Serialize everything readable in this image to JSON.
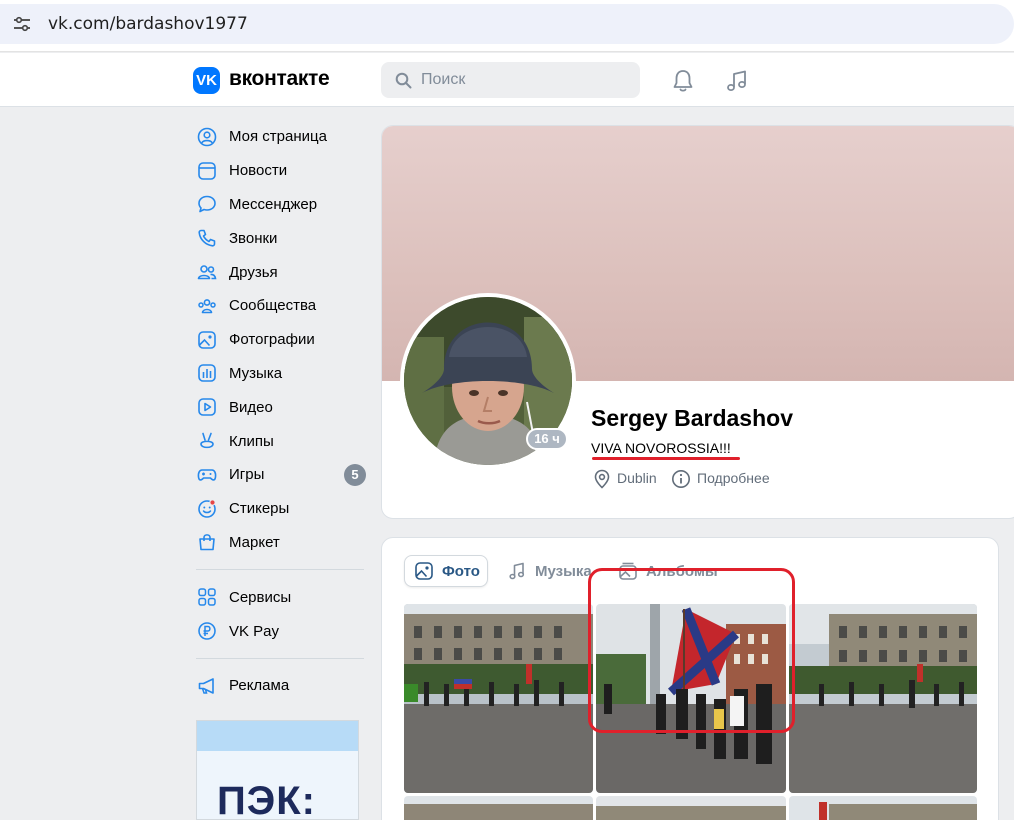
{
  "browser": {
    "url": "vk.com/bardashov1977"
  },
  "header": {
    "logo_text": "VK",
    "brand": "вконтакте",
    "search_placeholder": "Поиск"
  },
  "sidebar": {
    "items": [
      {
        "label": "Моя страница",
        "icon": "user-circle-icon"
      },
      {
        "label": "Новости",
        "icon": "news-icon"
      },
      {
        "label": "Мессенджер",
        "icon": "message-bubble-icon"
      },
      {
        "label": "Звонки",
        "icon": "phone-icon"
      },
      {
        "label": "Друзья",
        "icon": "friends-icon"
      },
      {
        "label": "Сообщества",
        "icon": "communities-icon"
      },
      {
        "label": "Фотографии",
        "icon": "photo-icon"
      },
      {
        "label": "Музыка",
        "icon": "music-bars-icon"
      },
      {
        "label": "Видео",
        "icon": "video-icon"
      },
      {
        "label": "Клипы",
        "icon": "clips-icon"
      },
      {
        "label": "Игры",
        "icon": "gamepad-icon",
        "badge": "5"
      },
      {
        "label": "Стикеры",
        "icon": "sticker-icon"
      },
      {
        "label": "Маркет",
        "icon": "market-bag-icon"
      }
    ],
    "services": [
      {
        "label": "Сервисы",
        "icon": "services-grid-icon"
      },
      {
        "label": "VK Pay",
        "icon": "ruble-icon"
      }
    ],
    "ads": {
      "label": "Реклама",
      "icon": "megaphone-icon"
    },
    "promo_text": "ПЭК:"
  },
  "profile": {
    "name": "Sergey Bardashov",
    "status": "VIVA NOVOROSSIA!!!",
    "online": "16 ч",
    "city": "Dublin",
    "details_label": "Подробнее"
  },
  "media": {
    "tabs": [
      {
        "label": "Фото",
        "active": true,
        "icon": "photo-tab-icon"
      },
      {
        "label": "Музыка",
        "active": false,
        "icon": "music-note-icon"
      },
      {
        "label": "Альбомы",
        "active": false,
        "icon": "albums-icon"
      }
    ]
  },
  "colors": {
    "vk_blue": "#0077ff",
    "link_blue": "#2a5885",
    "highlight_red": "#e0202b",
    "page_bg": "#edeef0"
  }
}
